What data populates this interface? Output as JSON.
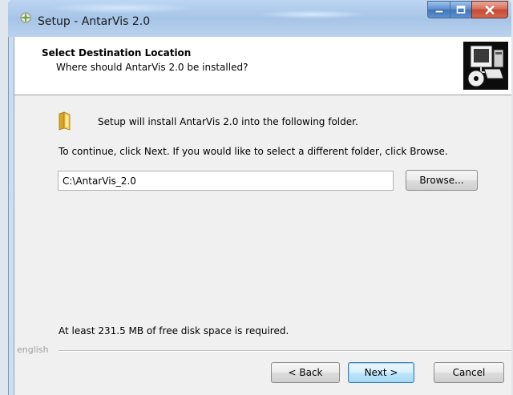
{
  "window": {
    "title": "Setup - AntarVis 2.0",
    "icon": "installer-icon",
    "controls": {
      "minimize": "minimize-icon",
      "maximize": "maximize-icon",
      "close": "close-icon"
    }
  },
  "header": {
    "title": "Select Destination Location",
    "subtitle": "Where should AntarVis 2.0 be installed?",
    "image": "computer-disk-icon"
  },
  "body": {
    "folder_icon": "folder-icon",
    "install_text": "Setup will install AntarVis 2.0 into the following folder.",
    "instruction_text": "To continue, click Next. If you would like to select a different folder, click Browse.",
    "path_value": "C:\\AntarVis_2.0",
    "browse_label": "Browse...",
    "disk_space_text": "At least 231.5 MB of free disk space is required."
  },
  "footer": {
    "language_label": "english",
    "back_label": "< Back",
    "next_label": "Next >",
    "cancel_label": "Cancel"
  }
}
